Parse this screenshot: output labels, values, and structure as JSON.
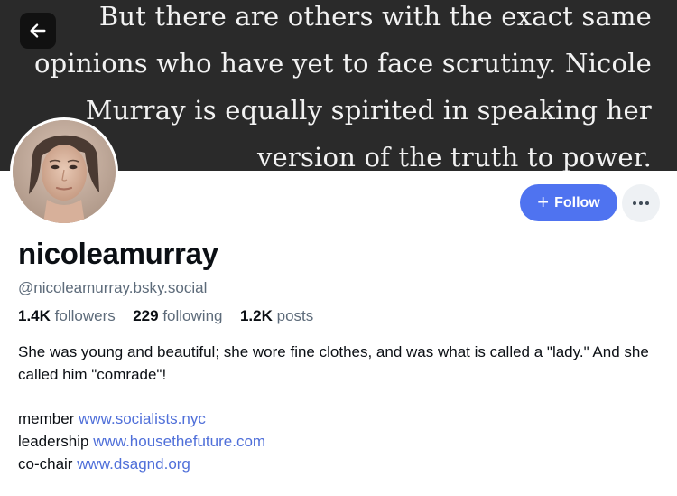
{
  "banner": {
    "lines": [
      "But there are others with the exact same",
      "opinions who have yet to face scrutiny. Nicole",
      "Murray is equally spirited in speaking her",
      "version of the truth to power."
    ]
  },
  "back_icon": "arrow-left-icon",
  "profile": {
    "display_name": "nicoleamurray",
    "handle": "@nicoleamurray.bsky.social"
  },
  "actions": {
    "follow_label": "Follow",
    "follow_icon": "plus-icon",
    "more_icon": "more-horizontal-icon"
  },
  "stats": {
    "followers_count": "1.4K",
    "followers_label": "followers",
    "following_count": "229",
    "following_label": "following",
    "posts_count": "1.2K",
    "posts_label": "posts"
  },
  "bio": {
    "text": "She was young and beautiful; she wore fine clothes, and was what is called a \"lady.\" And she called him \"comrade\"!",
    "links": [
      {
        "prefix": "member",
        "url": "www.socialists.nyc"
      },
      {
        "prefix": "leadership",
        "url": "www.housethefuture.com"
      },
      {
        "prefix": "co-chair",
        "url": "www.dsagnd.org"
      }
    ]
  },
  "colors": {
    "accent": "#4f73f0",
    "link": "#4f6fd9",
    "muted_text": "#5d6b7a",
    "banner_bg": "#2a2a2a"
  }
}
